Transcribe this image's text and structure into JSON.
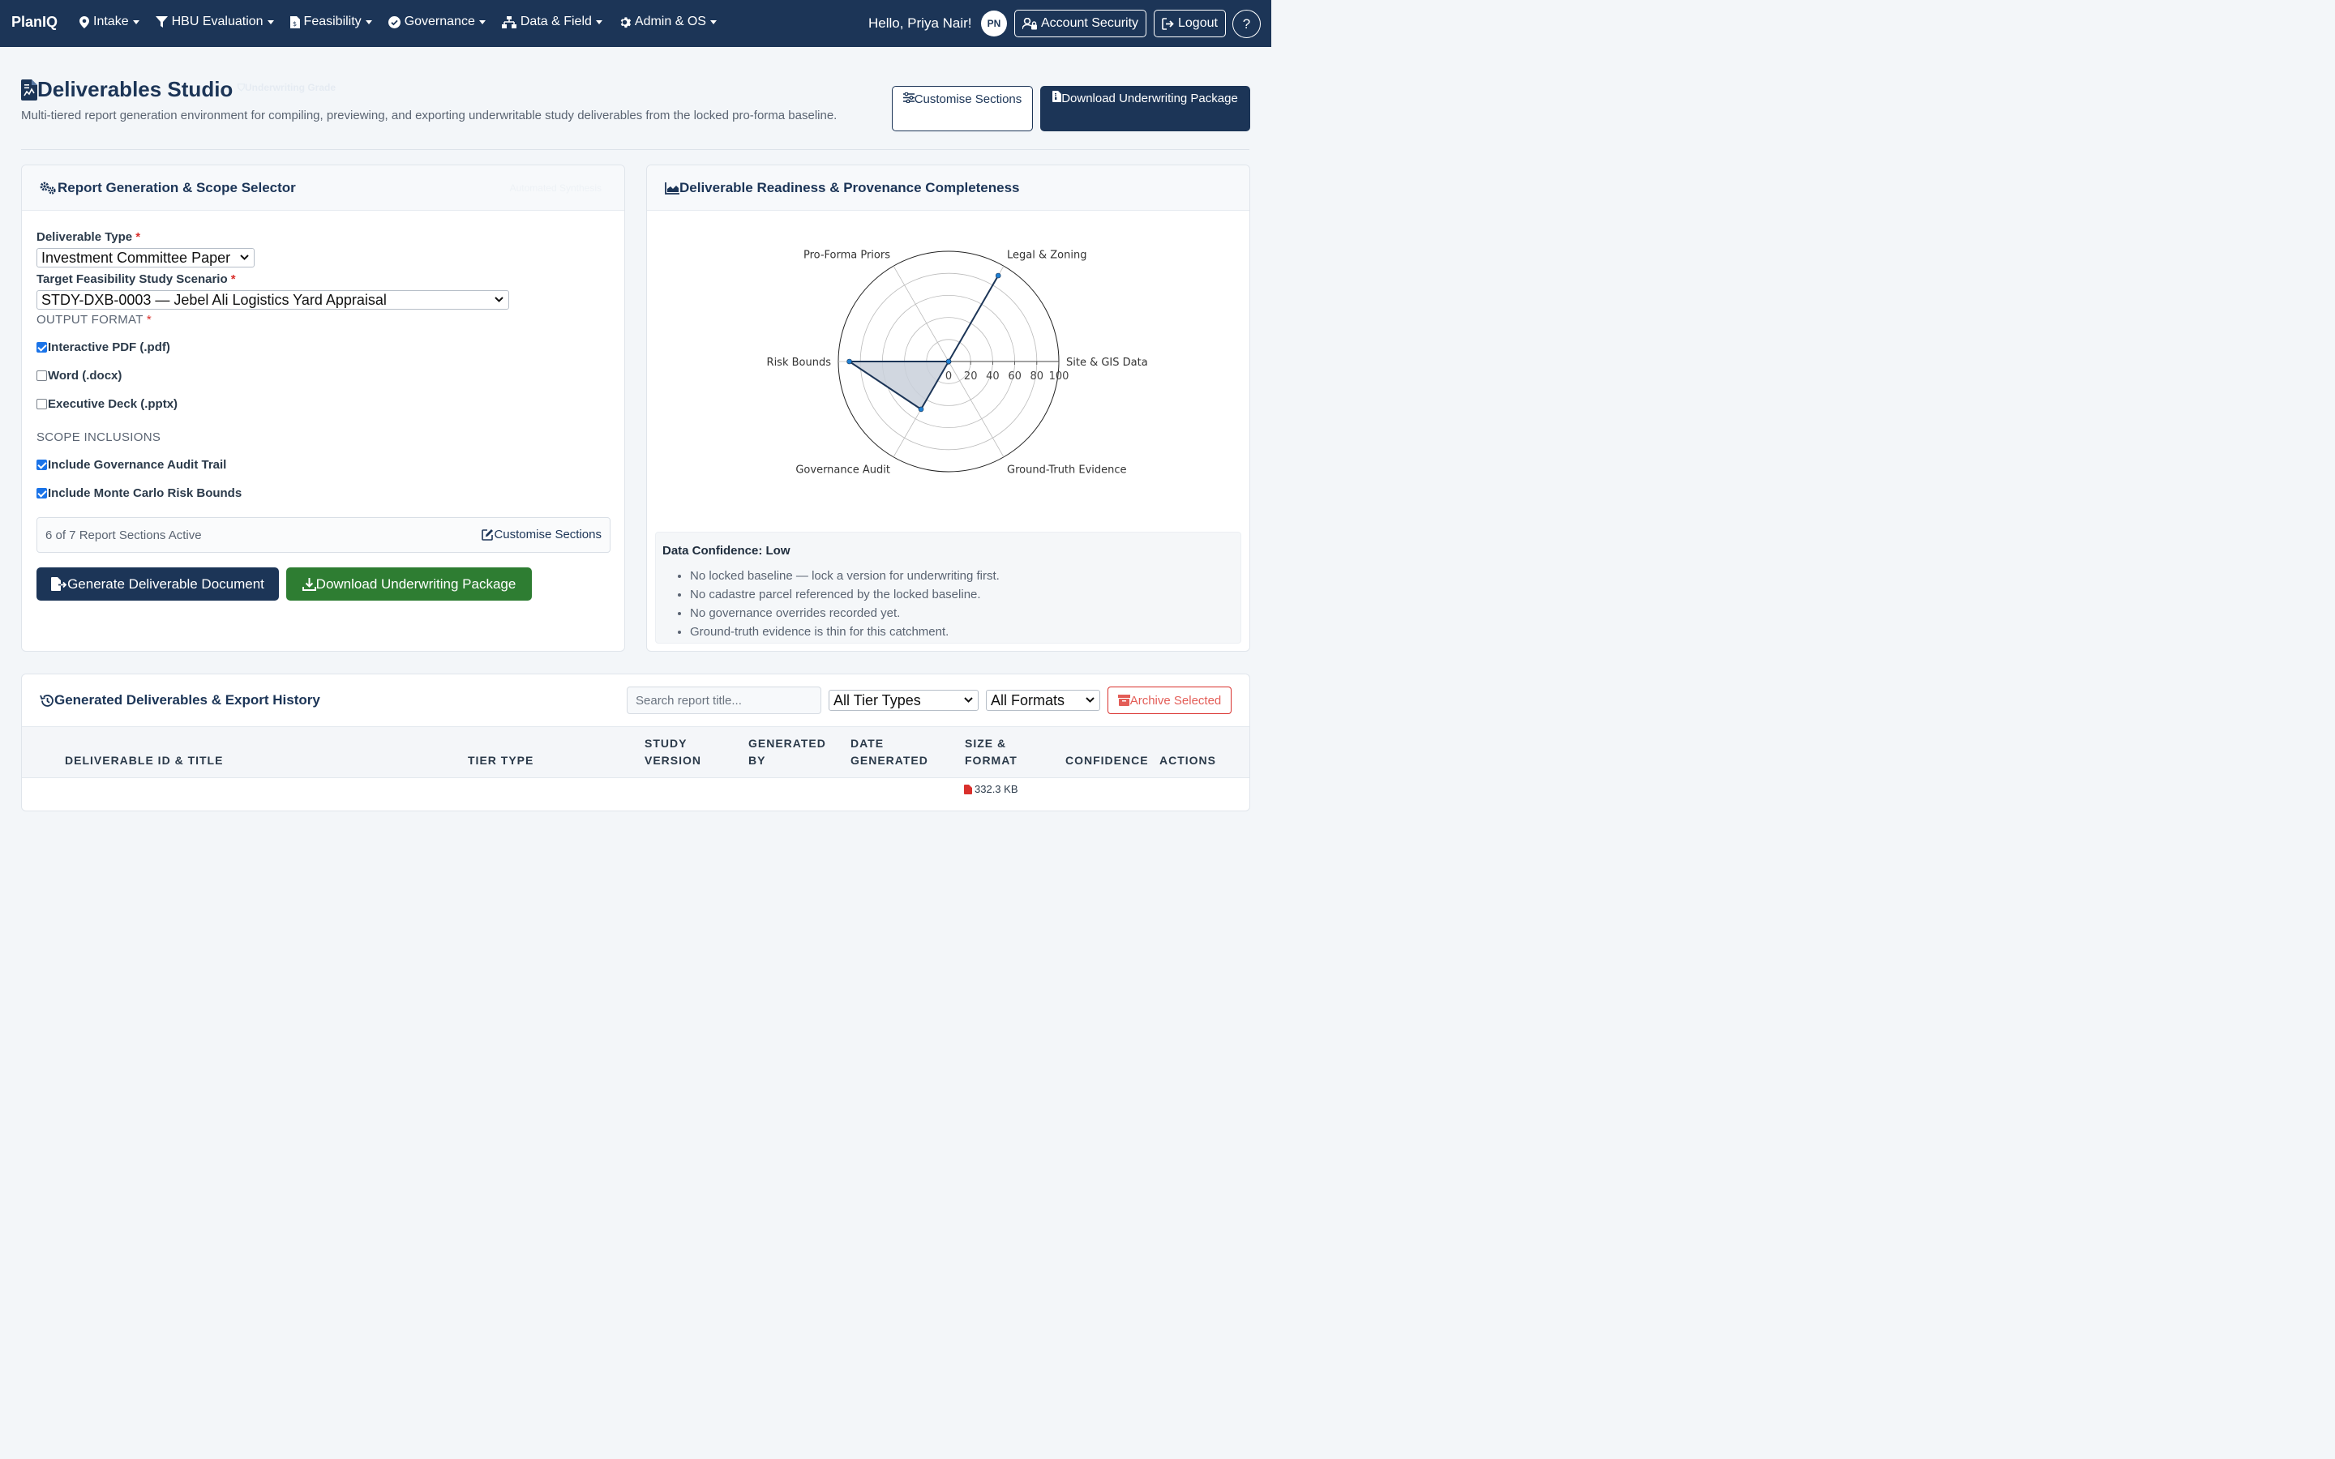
{
  "navbar": {
    "brand": "PlanIQ",
    "items": [
      {
        "label": "Intake",
        "icon": "map-pin-icon"
      },
      {
        "label": "HBU Evaluation",
        "icon": "filter-icon"
      },
      {
        "label": "Feasibility",
        "icon": "file-dollar-icon"
      },
      {
        "label": "Governance",
        "icon": "check-circle-icon"
      },
      {
        "label": "Data & Field",
        "icon": "sitemap-icon"
      },
      {
        "label": "Admin & OS",
        "icon": "gear-icon"
      }
    ],
    "greeting": "Hello, Priya Nair!",
    "avatar_initials": "PN",
    "account_security": "Account Security",
    "logout": "Logout",
    "help": "?"
  },
  "header": {
    "title": "Deliverables Studio",
    "badge": "Underwriting Grade",
    "subtitle": "Multi-tiered report generation environment for compiling, previewing, and exporting underwritable study deliverables from the locked pro-forma baseline.",
    "customise_btn": "Customise Sections",
    "download_btn": "Download Underwriting Package"
  },
  "generator": {
    "title": "Report Generation & Scope Selector",
    "badge": "Automated Synthesis",
    "deliverable_type_label": "Deliverable Type",
    "deliverable_type_value": "Investment Committee Paper",
    "scenario_label": "Target Feasibility Study Scenario",
    "scenario_value": "STDY-DXB-0003 — Jebel Ali Logistics Yard Appraisal",
    "output_format_label": "OUTPUT FORMAT",
    "formats": [
      {
        "label": "Interactive PDF (.pdf)",
        "checked": true
      },
      {
        "label": "Word (.docx)",
        "checked": false
      },
      {
        "label": "Executive Deck (.pptx)",
        "checked": false
      }
    ],
    "scope_label": "SCOPE INCLUSIONS",
    "scope": [
      {
        "label": "Include Governance Audit Trail",
        "checked": true
      },
      {
        "label": "Include Monte Carlo Risk Bounds",
        "checked": true
      }
    ],
    "sections_active": "6 of 7 Report Sections Active",
    "customise_link": "Customise Sections",
    "generate_btn": "Generate Deliverable Document",
    "download_btn": "Download Underwriting Package",
    "required_mark": "*"
  },
  "readiness": {
    "title": "Deliverable Readiness & Provenance Completeness",
    "confidence_title": "Data Confidence: Low",
    "confidence_notes": [
      "No locked baseline — lock a version for underwriting first.",
      "No cadastre parcel referenced by the locked baseline.",
      "No governance overrides recorded yet.",
      "Ground-truth evidence is thin for this catchment."
    ]
  },
  "chart_data": {
    "type": "radar",
    "categories": [
      "Site & GIS Data",
      "Legal & Zoning",
      "Pro-Forma Priors",
      "Risk Bounds",
      "Governance Audit",
      "Ground-Truth Evidence"
    ],
    "values": [
      0,
      90,
      0,
      90,
      50,
      0
    ],
    "rlim": [
      0,
      100
    ],
    "radial_ticks": [
      "0",
      "20",
      "40",
      "60",
      "80",
      "100"
    ],
    "colors": {
      "line": "#1c3557",
      "fill": "#c9d0da",
      "point": "#1f7fd1"
    }
  },
  "history": {
    "title": "Generated Deliverables & Export History",
    "search_placeholder": "Search report title...",
    "tier_filter": "All Tier Types",
    "format_filter": "All Formats",
    "archive_btn": "Archive Selected",
    "columns": [
      "DELIVERABLE ID & TITLE",
      "TIER TYPE",
      "STUDY VERSION",
      "GENERATED BY",
      "DATE GENERATED",
      "SIZE & FORMAT",
      "CONFIDENCE",
      "ACTIONS"
    ],
    "first_row_size": "332.3 KB"
  }
}
